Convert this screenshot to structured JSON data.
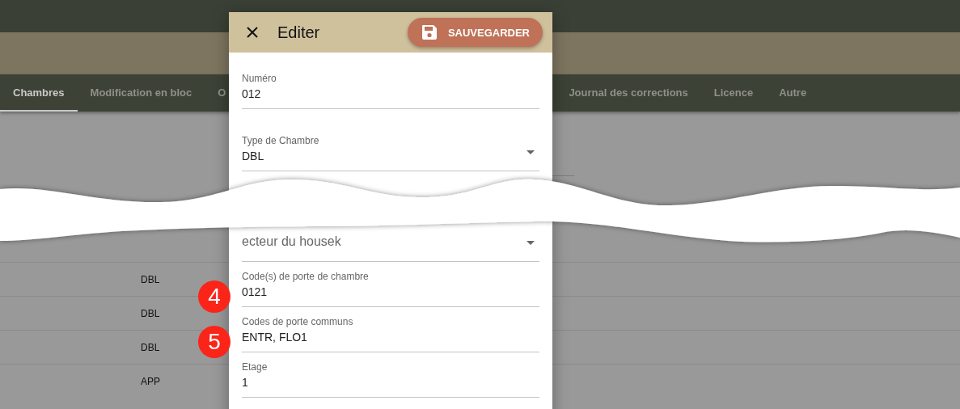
{
  "tabs": [
    {
      "label": "Chambres",
      "selected": true
    },
    {
      "label": "Modification en bloc",
      "selected": false
    },
    {
      "label": "O",
      "selected": false
    },
    {
      "label": "Journal des corrections",
      "selected": false
    },
    {
      "label": "Licence",
      "selected": false
    },
    {
      "label": "Autre",
      "selected": false
    }
  ],
  "rows": [
    {
      "type": "DBL"
    },
    {
      "type": "DBL"
    },
    {
      "type": "DBL"
    },
    {
      "type": "APP"
    }
  ],
  "dialog": {
    "title": "Editer",
    "save_button": "SAUVEGARDER",
    "fields": [
      {
        "kind": "text",
        "label": "Numéro",
        "value": "012"
      },
      {
        "kind": "select",
        "label": "Type de Chambre",
        "value": "DBL"
      },
      {
        "kind": "select",
        "placeholder": "ecteur du housek"
      },
      {
        "kind": "text",
        "label": "Code(s) de porte de chambre",
        "value": "0121",
        "badge": "4"
      },
      {
        "kind": "text",
        "label": "Codes de porte communs",
        "value": "ENTR, FLO1",
        "badge": "5"
      },
      {
        "kind": "text",
        "label": "Etage",
        "value": "1"
      }
    ]
  }
}
